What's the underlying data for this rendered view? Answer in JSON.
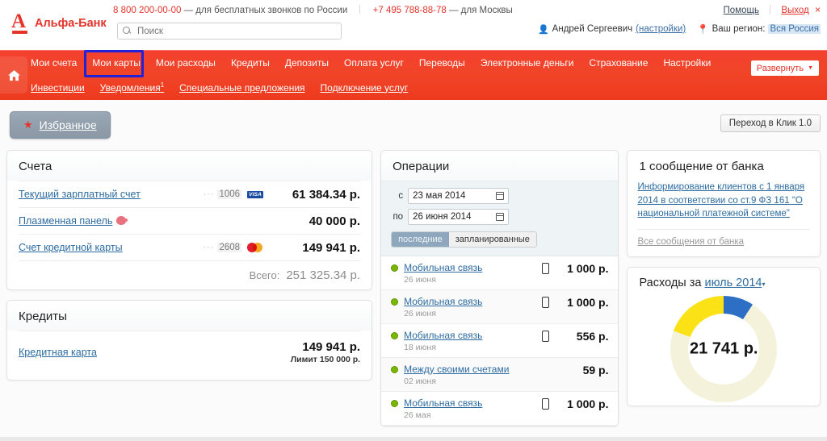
{
  "header": {
    "logo_text": "Альфа-Банк",
    "logo_letter": "A",
    "phone_free": "8 800 200-00-00",
    "phone_free_desc": "— для бесплатных звонков по России",
    "phone_msk": "+7 495 788-88-78",
    "phone_msk_desc": "— для Москвы",
    "help_label": "Помощь",
    "logout_label": "Выход",
    "close_glyph": "×",
    "search_placeholder": "Поиск",
    "search_value": "",
    "user_name": "Андрей Сергеевич",
    "user_settings": "(настройки)",
    "region_label": "Ваш регион:",
    "region_value": "Вся Россия"
  },
  "nav": {
    "row1": [
      {
        "label": "Мои счета",
        "sup": ""
      },
      {
        "label": "Мои карты",
        "sup": ""
      },
      {
        "label": "Мои расходы",
        "sup": ""
      },
      {
        "label": "Кредиты",
        "sup": ""
      },
      {
        "label": "Депозиты",
        "sup": ""
      },
      {
        "label": "Оплата услуг",
        "sup": ""
      },
      {
        "label": "Переводы",
        "sup": ""
      },
      {
        "label": "Электронные деньги",
        "sup": ""
      },
      {
        "label": "Страхование",
        "sup": ""
      },
      {
        "label": "Настройки",
        "sup": ""
      }
    ],
    "row2": [
      {
        "label": "Инвестиции",
        "sup": ""
      },
      {
        "label": "Уведомления",
        "sup": "1"
      },
      {
        "label": "Специальные предложения",
        "sup": ""
      },
      {
        "label": "Подключение услуг",
        "sup": ""
      }
    ],
    "expand_label": "Развернуть",
    "expand_caret": "▼",
    "highlight_target": "Мои карты",
    "highlight_color": "#1f22d8"
  },
  "toolbar": {
    "favorites_label": "Избранное",
    "favorites_star": "★",
    "klik_label": "Переход в Клик 1.0"
  },
  "accounts": {
    "title": "Счета",
    "rows": [
      {
        "name": "Текущий зарплатный счет",
        "dots": "···",
        "last4": "1006",
        "card": "visa",
        "amount": "61 384.34 р."
      },
      {
        "name": "Плазменная панель",
        "dots": "",
        "last4": "",
        "card": "piggy",
        "amount": "40 000 р."
      },
      {
        "name": "Счет кредитной карты",
        "dots": "···",
        "last4": "2608",
        "card": "mc",
        "amount": "149 941 р."
      }
    ],
    "total_label": "Всего:",
    "total_value": "251 325.34 р."
  },
  "credits": {
    "title": "Кредиты",
    "rows": [
      {
        "name": "Кредитная карта",
        "amount": "149 941 р.",
        "limit": "Лимит 150 000 р."
      }
    ]
  },
  "operations": {
    "title": "Операции",
    "from_label": "с",
    "from_value": "23 мая 2014",
    "to_label": "по",
    "to_value": "26 июня 2014",
    "tab_recent": "последние",
    "tab_planned": "запланированные",
    "rows": [
      {
        "title": "Мобильная связь",
        "date": "26 июня",
        "icon": "phone",
        "amount": "1 000 р."
      },
      {
        "title": "Мобильная связь",
        "date": "26 июня",
        "icon": "phone",
        "amount": "1 000 р."
      },
      {
        "title": "Мобильная связь",
        "date": "18 июня",
        "icon": "phone",
        "amount": "556 р."
      },
      {
        "title": "Между своими счетами",
        "date": "02 июня",
        "icon": "none",
        "amount": "59 р."
      },
      {
        "title": "Мобильная связь",
        "date": "26 мая",
        "icon": "phone",
        "amount": "1 000 р."
      }
    ]
  },
  "messages": {
    "title": "1 сообщение от банка",
    "link_text": "Информирование клиентов с 1 января 2014 в соответствии со ст.9 ФЗ 161 \"О национальной платежной системе\"",
    "all_label": "Все сообщения от банка"
  },
  "expenses": {
    "title_prefix": "Расходы за",
    "period": "июль 2014",
    "caret": "▾",
    "total": "21 741 р."
  },
  "chart_data": {
    "type": "pie",
    "title": "Расходы за июль 2014",
    "center_label": "21 741 р.",
    "segments": [
      {
        "name": "blue-segment",
        "color": "#2c6fc4",
        "start_deg": 0,
        "end_deg": 33
      },
      {
        "name": "empty-segment",
        "color": "#f5f2dc",
        "start_deg": 33,
        "end_deg": 290
      },
      {
        "name": "yellow-segment",
        "color": "#fbe216",
        "start_deg": 290,
        "end_deg": 360
      }
    ],
    "legend_position": "none",
    "grid": false
  }
}
